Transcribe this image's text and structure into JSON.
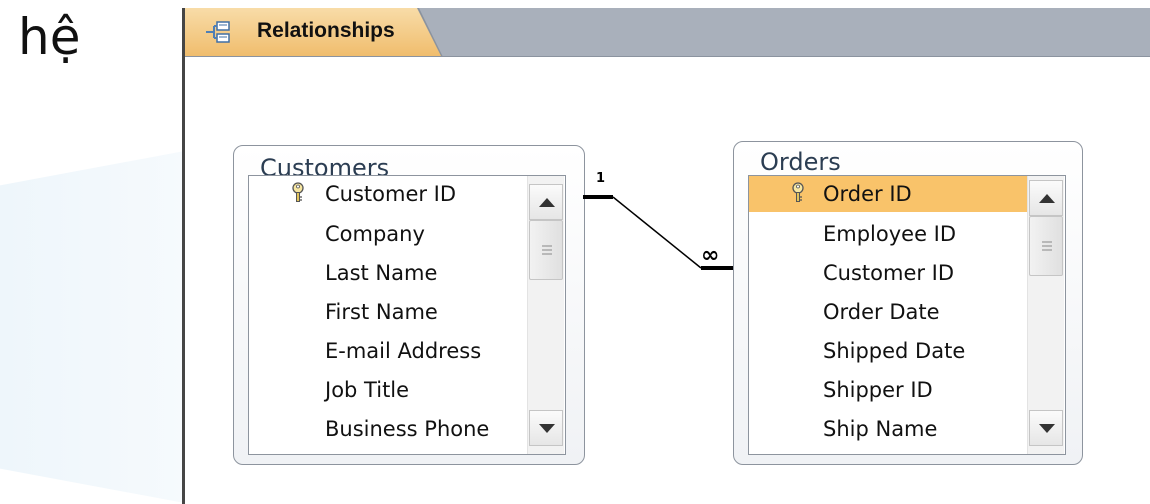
{
  "side_text": "hệ",
  "tab": {
    "label": "Relationships",
    "icon": "relationships-icon"
  },
  "customers": {
    "title": "Customers",
    "fields": [
      "Customer ID",
      "Company",
      "Last Name",
      "First Name",
      "E-mail Address",
      "Job Title",
      "Business Phone"
    ],
    "key_field_index": 0
  },
  "orders": {
    "title": "Orders",
    "fields": [
      "Order ID",
      "Employee ID",
      "Customer ID",
      "Order Date",
      "Shipped Date",
      "Shipper ID",
      "Ship Name"
    ],
    "key_field_index": 0,
    "selected_field_index": 0
  },
  "relationship": {
    "one_side": "1",
    "many_side": "∞"
  },
  "colors": {
    "accent": "#f9c36a",
    "tabbar": "#a9b0bb",
    "title_text": "#2b3d52"
  }
}
